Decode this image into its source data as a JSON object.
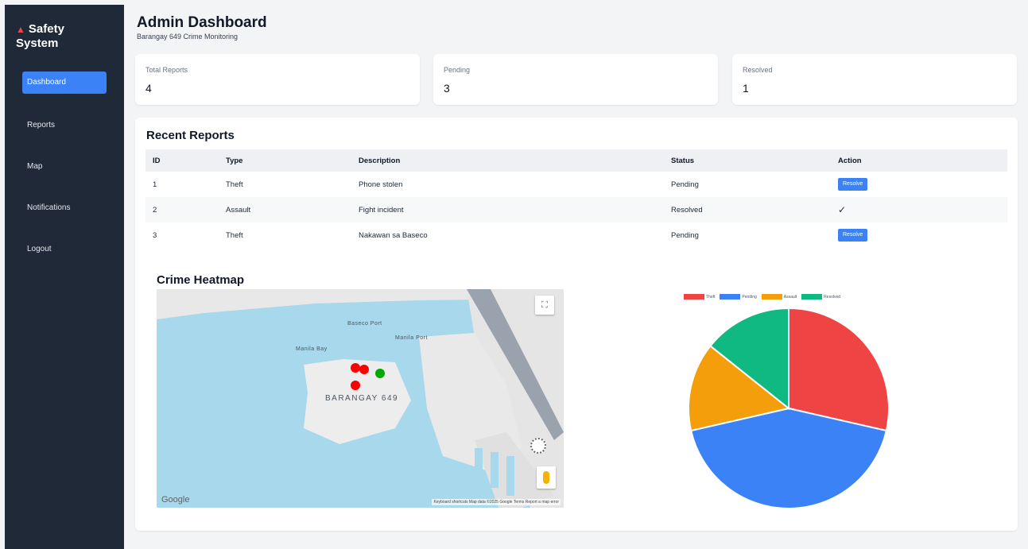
{
  "sidebar": {
    "brand_icon": "siren-icon",
    "brand_line1": "Safety",
    "brand_line2": "System",
    "items": [
      {
        "label": "Dashboard"
      },
      {
        "label": "Reports"
      },
      {
        "label": "Map"
      },
      {
        "label": "Notifications"
      },
      {
        "label": "Logout"
      }
    ]
  },
  "header": {
    "title": "Admin Dashboard",
    "subtitle": "Barangay 649 Crime Monitoring"
  },
  "stats": [
    {
      "label": "Total Reports",
      "value": "4"
    },
    {
      "label": "Pending",
      "value": "3"
    },
    {
      "label": "Resolved",
      "value": "1"
    }
  ],
  "reports": {
    "title": "Recent Reports",
    "columns": [
      "ID",
      "Type",
      "Description",
      "Status",
      "Action"
    ],
    "rows": [
      {
        "id": "1",
        "type": "Theft",
        "description": "Phone stolen",
        "status": "Pending",
        "action": "Resolve"
      },
      {
        "id": "2",
        "type": "Assault",
        "description": "Fight incident",
        "status": "Resolved",
        "action": "✓"
      },
      {
        "id": "3",
        "type": "Theft",
        "description": "Nakawan sa Baseco",
        "status": "Pending",
        "action": "Resolve"
      }
    ]
  },
  "heatmap": {
    "title": "Crime Heatmap",
    "area_label": "BARANGAY 649",
    "labels": [
      "Manila Port",
      "Baseco Port",
      "Manila Bay"
    ],
    "attribution": "Google",
    "footer": "Keyboard shortcuts   Map data ©2025 Google   Terms   Report a map error",
    "markers": [
      {
        "color": "#ff0000"
      },
      {
        "color": "#ff0000"
      },
      {
        "color": "#ff0000"
      },
      {
        "color": "#00aa00"
      }
    ]
  },
  "chart_data": {
    "type": "pie",
    "legend": [
      "Theft",
      "Pending",
      "Assault",
      "Resolved"
    ],
    "values": [
      2,
      3,
      1,
      1
    ],
    "colors": [
      "#ef4444",
      "#3b82f6",
      "#f59e0b",
      "#10b981"
    ],
    "legend_position": "top"
  }
}
